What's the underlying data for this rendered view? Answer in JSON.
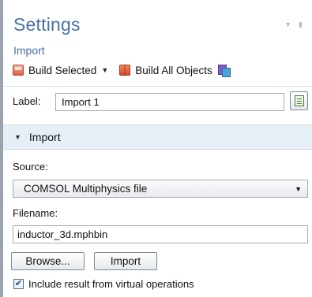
{
  "panel": {
    "title": "Settings",
    "subtitle": "Import"
  },
  "toolbar": {
    "build_selected_label": "Build Selected",
    "build_all_label": "Build All Objects"
  },
  "label_field": {
    "label": "Label:",
    "value": "Import 1"
  },
  "section": {
    "title": "Import"
  },
  "source": {
    "label": "Source:",
    "selected": "COMSOL Multiphysics file"
  },
  "filename": {
    "label": "Filename:",
    "value": "inductor_3d.mphbin"
  },
  "buttons": {
    "browse_label": "Browse...",
    "import_label": "Import"
  },
  "options": {
    "include_virtual_label": "Include result from virtual operations",
    "include_virtual_checked": true
  },
  "icons": {
    "build_selected": "build-selected-icon",
    "build_all": "build-all-icon",
    "extra": "geometry-objects-icon",
    "label_action": "label-edit-icon"
  }
}
